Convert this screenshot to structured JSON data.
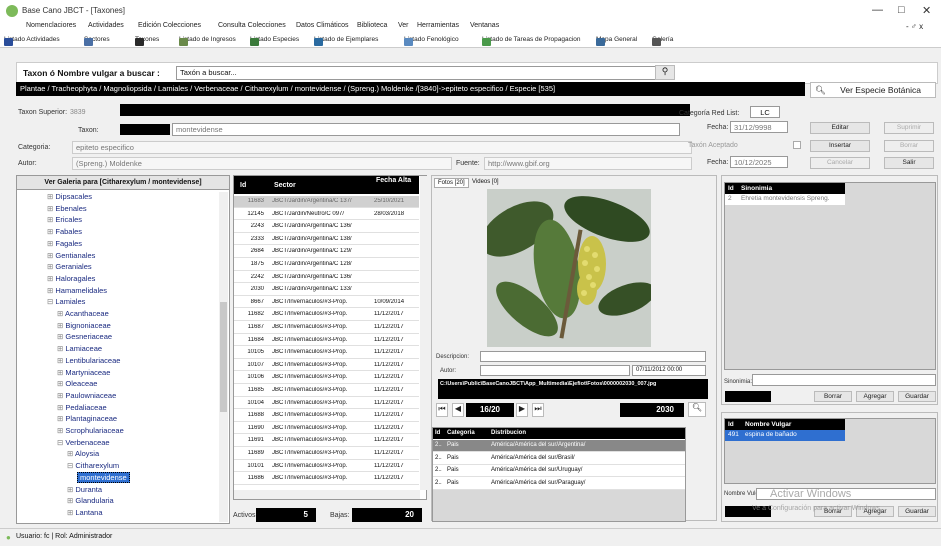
{
  "window": {
    "title": "Base Cano JBCT - [Taxones]",
    "minimize": "—",
    "maximize": "□",
    "close": "✕",
    "inner_controls": "- ♂ x"
  },
  "menu": [
    "Nomenclaciores",
    "Actividades",
    "Edición Colecciones",
    "Consulta Colecciones",
    "Datos Climáticos",
    "Biblioteca",
    "Ver",
    "Herramientas",
    "Ventanas"
  ],
  "toolbar": [
    {
      "label": "Listado Actividades",
      "color": "#2a4d9a"
    },
    {
      "label": "Sectores",
      "color": "#4a6fa5"
    },
    {
      "label": "Taxones",
      "color": "#2a2a2a"
    },
    {
      "label": "Listado de Ingresos",
      "color": "#6a8a4a"
    },
    {
      "label": "Listado Especies",
      "color": "#3a7a3a"
    },
    {
      "label": "Listado de Ejemplares",
      "color": "#2a6aa0"
    },
    {
      "label": "Listado Fenológico",
      "color": "#5a8ac0"
    },
    {
      "label": "Listado de Tareas de Propagacion",
      "color": "#4a9a4a"
    },
    {
      "label": "Mapa General",
      "color": "#3a6a9a"
    },
    {
      "label": "Galería",
      "color": "#555555"
    }
  ],
  "search": {
    "label": "Taxon ó Nombre vulgar a buscar :",
    "placeholder": "Taxón a buscar..."
  },
  "path": "Plantae / Tracheophyta / Magnoliopsida / Lamiales / Verbenaceae / Citharexylum / montevidense / (Spreng.) Moldenke /[3840]->epiteto especifico / Especie [535]",
  "ver_especie": "Ver Especie Botánica",
  "form": {
    "taxon_superior_label": "Taxon Superior:",
    "taxon_superior_value": "3839",
    "taxon_label": "Taxon:",
    "taxon_value": "montevidense",
    "categoria_label": "Categoria:",
    "categoria_value": "epiteto especifico",
    "autor_label": "Autor:",
    "autor_value": "(Spreng.) Moldenke",
    "fuente_label": "Fuente:",
    "fuente_value": "http://www.gbif.org",
    "red_list_label": "Categoría Red List:",
    "red_list_value": "LC",
    "fecha_label": "Fecha:",
    "fecha1": "31/12/9998",
    "taxon_aceptado_label": "Taxón Aceptado",
    "fecha2": "10/12/2025"
  },
  "buttons": {
    "editar": "Editar",
    "suprimir": "Suprimir",
    "insertar": "Insertar",
    "borrar": "Borrar",
    "cancelar": "Cancelar",
    "salir": "Salir"
  },
  "gallery_title": "Ver Galeria para [Citharexylum / montevidense]",
  "tree": [
    {
      "label": "Dipsacales",
      "level": 1
    },
    {
      "label": "Ebenales",
      "level": 1
    },
    {
      "label": "Ericales",
      "level": 1
    },
    {
      "label": "Fabales",
      "level": 1
    },
    {
      "label": "Fagales",
      "level": 1
    },
    {
      "label": "Gentianales",
      "level": 1
    },
    {
      "label": "Geraniales",
      "level": 1
    },
    {
      "label": "Haloragales",
      "level": 1
    },
    {
      "label": "Hamamelidales",
      "level": 1
    },
    {
      "label": "Lamiales",
      "level": 1
    },
    {
      "label": "Acanthaceae",
      "level": 2
    },
    {
      "label": "Bignoniaceae",
      "level": 2
    },
    {
      "label": "Gesneriaceae",
      "level": 2
    },
    {
      "label": "Lamiaceae",
      "level": 2
    },
    {
      "label": "Lentibulariaceae",
      "level": 2
    },
    {
      "label": "Martyniaceae",
      "level": 2
    },
    {
      "label": "Oleaceae",
      "level": 2
    },
    {
      "label": "Paulowniaceae",
      "level": 2
    },
    {
      "label": "Pedaliaceae",
      "level": 2
    },
    {
      "label": "Plantaginaceae",
      "level": 2
    },
    {
      "label": "Scrophulariaceae",
      "level": 2
    },
    {
      "label": "Verbenaceae",
      "level": 2
    },
    {
      "label": "Aloysia",
      "level": 3
    },
    {
      "label": "Citharexylum",
      "level": 3
    },
    {
      "label": "montevidense",
      "level": 4
    },
    {
      "label": "Duranta",
      "level": 3
    },
    {
      "label": "Glandularia",
      "level": 3
    },
    {
      "label": "Lantana",
      "level": 3
    }
  ],
  "specimens": {
    "headers": [
      "Id",
      "Sector",
      "Fecha Alta"
    ],
    "rows": [
      [
        "11683",
        "JBCT/Jardin/Argentina/C 137/",
        "25/10/2021"
      ],
      [
        "12145",
        "JBCT/Jardin/Neutro/C 097/",
        "28/03/2018"
      ],
      [
        "2243",
        "JBCT/Jardin/Argentina/C 136/",
        ""
      ],
      [
        "2333",
        "JBCT/Jardin/Argentina/C 138/",
        ""
      ],
      [
        "2684",
        "JBCT/Jardin/Argentina/C 129/",
        ""
      ],
      [
        "1875",
        "JBCT/Jardin/Argentina/C 128/",
        ""
      ],
      [
        "2242",
        "JBCT/Jardin/Argentina/C 136/",
        ""
      ],
      [
        "2030",
        "JBCT/Jardin/Argentina/C 133/",
        ""
      ],
      [
        "8667",
        "JBCT/Invernáculos/#3-Prop.",
        "10/09/2014"
      ],
      [
        "11682",
        "JBCT/Invernáculos/#3-Prop.",
        "11/12/2017"
      ],
      [
        "11687",
        "JBCT/Invernáculos/#3-Prop.",
        "11/12/2017"
      ],
      [
        "11684",
        "JBCT/Invernáculos/#3-Prop.",
        "11/12/2017"
      ],
      [
        "10105",
        "JBCT/Invernáculos/#3-Prop.",
        "11/12/2017"
      ],
      [
        "10107",
        "JBCT/Invernáculos/#3-Prop.",
        "11/12/2017"
      ],
      [
        "10106",
        "JBCT/Invernáculos/#3-Prop.",
        "11/12/2017"
      ],
      [
        "11685",
        "JBCT/Invernáculos/#3-Prop.",
        "11/12/2017"
      ],
      [
        "10104",
        "JBCT/Invernáculos/#3-Prop.",
        "11/12/2017"
      ],
      [
        "11688",
        "JBCT/Invernáculos/#3-Prop.",
        "11/12/2017"
      ],
      [
        "11690",
        "JBCT/Invernáculos/#3-Prop.",
        "11/12/2017"
      ],
      [
        "11691",
        "JBCT/Invernáculos/#3-Prop.",
        "11/12/2017"
      ],
      [
        "11689",
        "JBCT/Invernáculos/#3-Prop.",
        "11/12/2017"
      ],
      [
        "10101",
        "JBCT/Invernáculos/#3-Prop.",
        "11/12/2017"
      ],
      [
        "11686",
        "JBCT/Invernáculos/#3-Prop.",
        "11/12/2017"
      ]
    ],
    "activos_label": "Activos:",
    "activos": "5",
    "bajas_label": "Bajas:",
    "bajas": "20"
  },
  "photo_tabs": [
    "Fotos [20]",
    "Videos [0]"
  ],
  "photo": {
    "descripcion_label": "Descripcion:",
    "autor_label": "Autor:",
    "date": "07/11/2012 00:00",
    "path": "C:\\Users\\Public\\BaseCanoJBCT\\App_Multimedia\\Ejefiot\\Fotos\\0000002030_007.jpg",
    "counter": "16/20",
    "id": "2030"
  },
  "distribution": {
    "headers": [
      "Id",
      "Categoria",
      "Distribucion"
    ],
    "rows": [
      [
        "2..",
        "Pais",
        "América/América del sur/Argentina/"
      ],
      [
        "2..",
        "Pais",
        "América/América del sur/Brasil/"
      ],
      [
        "2..",
        "Pais",
        "América/América del sur/Uruguay/"
      ],
      [
        "2..",
        "Pais",
        "América/América del sur/Paraguay/"
      ]
    ]
  },
  "synonyms": {
    "headers": [
      "Id",
      "Sinonimia"
    ],
    "rows": [
      [
        "2",
        "Ehretia montevidensis Spreng."
      ]
    ],
    "label": "Sinonimia:"
  },
  "syn_buttons": {
    "borrar": "Borrar",
    "agregar": "Agregar",
    "guardar": "Guardar"
  },
  "vulgar": {
    "headers": [
      "Id",
      "Nombre Vulgar"
    ],
    "rows": [
      [
        "491",
        "espina de bañado"
      ]
    ],
    "label": "Nombre Vulgar:"
  },
  "watermark": {
    "line1": "Activar Windows",
    "line2": "Ve a Configuración para activar Windows."
  },
  "status": "Usuario: fc | Rol: Administrador"
}
